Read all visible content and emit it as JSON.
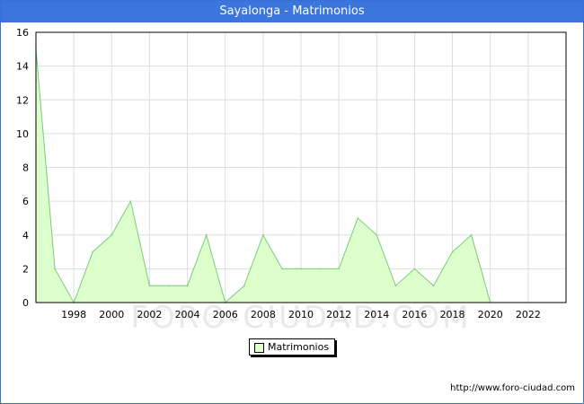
{
  "title": "Sayalonga - Matrimonios",
  "footer_url": "http://www.foro-ciudad.com",
  "watermark": "FORO-CIUDAD.COM",
  "colors": {
    "title_bar": "#3b76dd",
    "area_fill": "#ddffcc",
    "line": "#77cc77",
    "grid": "#dddddd"
  },
  "chart_data": {
    "type": "area",
    "title": "Sayalonga - Matrimonios",
    "xlabel": "",
    "ylabel": "",
    "x": [
      1996,
      1997,
      1998,
      1999,
      2000,
      2001,
      2002,
      2003,
      2004,
      2005,
      2006,
      2007,
      2008,
      2009,
      2010,
      2011,
      2012,
      2013,
      2014,
      2015,
      2016,
      2017,
      2018,
      2019,
      2020
    ],
    "series": [
      {
        "name": "Matrimonios",
        "values": [
          15,
          2,
          0,
          3,
          4,
          6,
          1,
          1,
          1,
          4,
          0,
          1,
          4,
          2,
          2,
          2,
          2,
          5,
          4,
          1,
          2,
          1,
          3,
          4,
          0
        ]
      }
    ],
    "xlim": [
      1996,
      2024
    ],
    "ylim": [
      0,
      16
    ],
    "x_ticks": [
      "1998",
      "2000",
      "2002",
      "2004",
      "2006",
      "2008",
      "2010",
      "2012",
      "2014",
      "2016",
      "2018",
      "2020",
      "2022"
    ],
    "y_ticks": [
      "0",
      "2",
      "4",
      "6",
      "8",
      "10",
      "12",
      "14",
      "16"
    ],
    "grid": true,
    "legend_position": "bottom-center"
  }
}
